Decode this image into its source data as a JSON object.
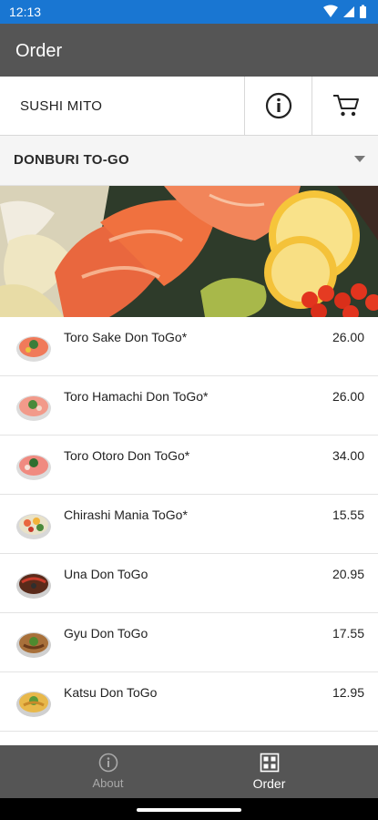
{
  "status_bar": {
    "time": "12:13"
  },
  "app_bar": {
    "title": "Order"
  },
  "store": {
    "name": "SUSHI MITO",
    "info_icon": "info-icon",
    "cart_icon": "cart-icon"
  },
  "category": {
    "name": "DONBURI TO-GO",
    "dropdown_icon": "caret-down-icon"
  },
  "menu": {
    "items": [
      {
        "name": "Toro Sake Don ToGo*",
        "price": "26.00"
      },
      {
        "name": "Toro Hamachi Don ToGo*",
        "price": "26.00"
      },
      {
        "name": "Toro Otoro Don ToGo*",
        "price": "34.00"
      },
      {
        "name": "Chirashi Mania ToGo*",
        "price": "15.55"
      },
      {
        "name": "Una Don ToGo",
        "price": "20.95"
      },
      {
        "name": "Gyu Don ToGo",
        "price": "17.55"
      },
      {
        "name": "Katsu Don ToGo",
        "price": "12.95"
      }
    ]
  },
  "bottom_nav": {
    "tabs": [
      {
        "label": "About",
        "icon": "info-icon",
        "active": false
      },
      {
        "label": "Order",
        "icon": "grid-icon",
        "active": true
      }
    ]
  }
}
